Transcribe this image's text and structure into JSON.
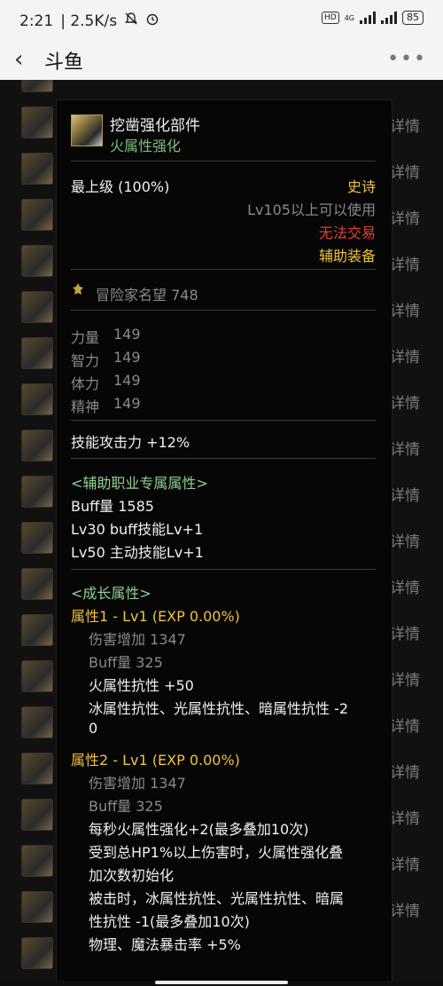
{
  "statusbar": {
    "time": "2:21",
    "speed": "| 2.5K/s",
    "mute_icon": "bell-off-icon",
    "alarm_icon": "alarm-icon",
    "hd": "HD",
    "net": "4G",
    "battery": "85"
  },
  "topbar": {
    "back_icon": "chevron-left-icon",
    "title": "斗鱼",
    "more_icon": "more-horizontal-icon"
  },
  "background": {
    "right_label": "详情"
  },
  "tooltip": {
    "name": "挖凿强化部件",
    "subtitle": "火属性强化",
    "grade": "最上级 (100%)",
    "rarity": "史诗",
    "level_req": "Lv105以上可以使用",
    "trade": "无法交易",
    "type": "辅助装备",
    "fame_label": "冒险家名望 748",
    "stats": [
      {
        "name": "力量",
        "value": "149"
      },
      {
        "name": "智力",
        "value": "149"
      },
      {
        "name": "体力",
        "value": "149"
      },
      {
        "name": "精神",
        "value": "149"
      }
    ],
    "skill_atk": "技能攻击力  +12%",
    "support_header": "<辅助职业专属属性>",
    "support_lines": [
      "Buff量  1585",
      "Lv30 buff技能Lv+1",
      "Lv50 主动技能Lv+1"
    ],
    "growth_header": "<成长属性>",
    "attr1": {
      "title": "属性1 - Lv1 (EXP 0.00%)",
      "dmg": "伤害增加  1347",
      "buff": "Buff量  325",
      "line1": "火属性抗性 +50",
      "line2": "冰属性抗性、光属性抗性、暗属性抗性 -2",
      "line3": "0"
    },
    "attr2": {
      "title": "属性2 - Lv1 (EXP 0.00%)",
      "dmg": "伤害增加  1347",
      "buff": "Buff量  325",
      "line1": "每秒火属性强化+2(最多叠加10次)",
      "line2": "受到总HP1%以上伤害时，火属性强化叠",
      "line3": "加次数初始化",
      "line4": "被击时，冰属性抗性、光属性抗性、暗属",
      "line5": "性抗性 -1(最多叠加10次)",
      "line6": "物理、魔法暴击率 +5%"
    }
  }
}
